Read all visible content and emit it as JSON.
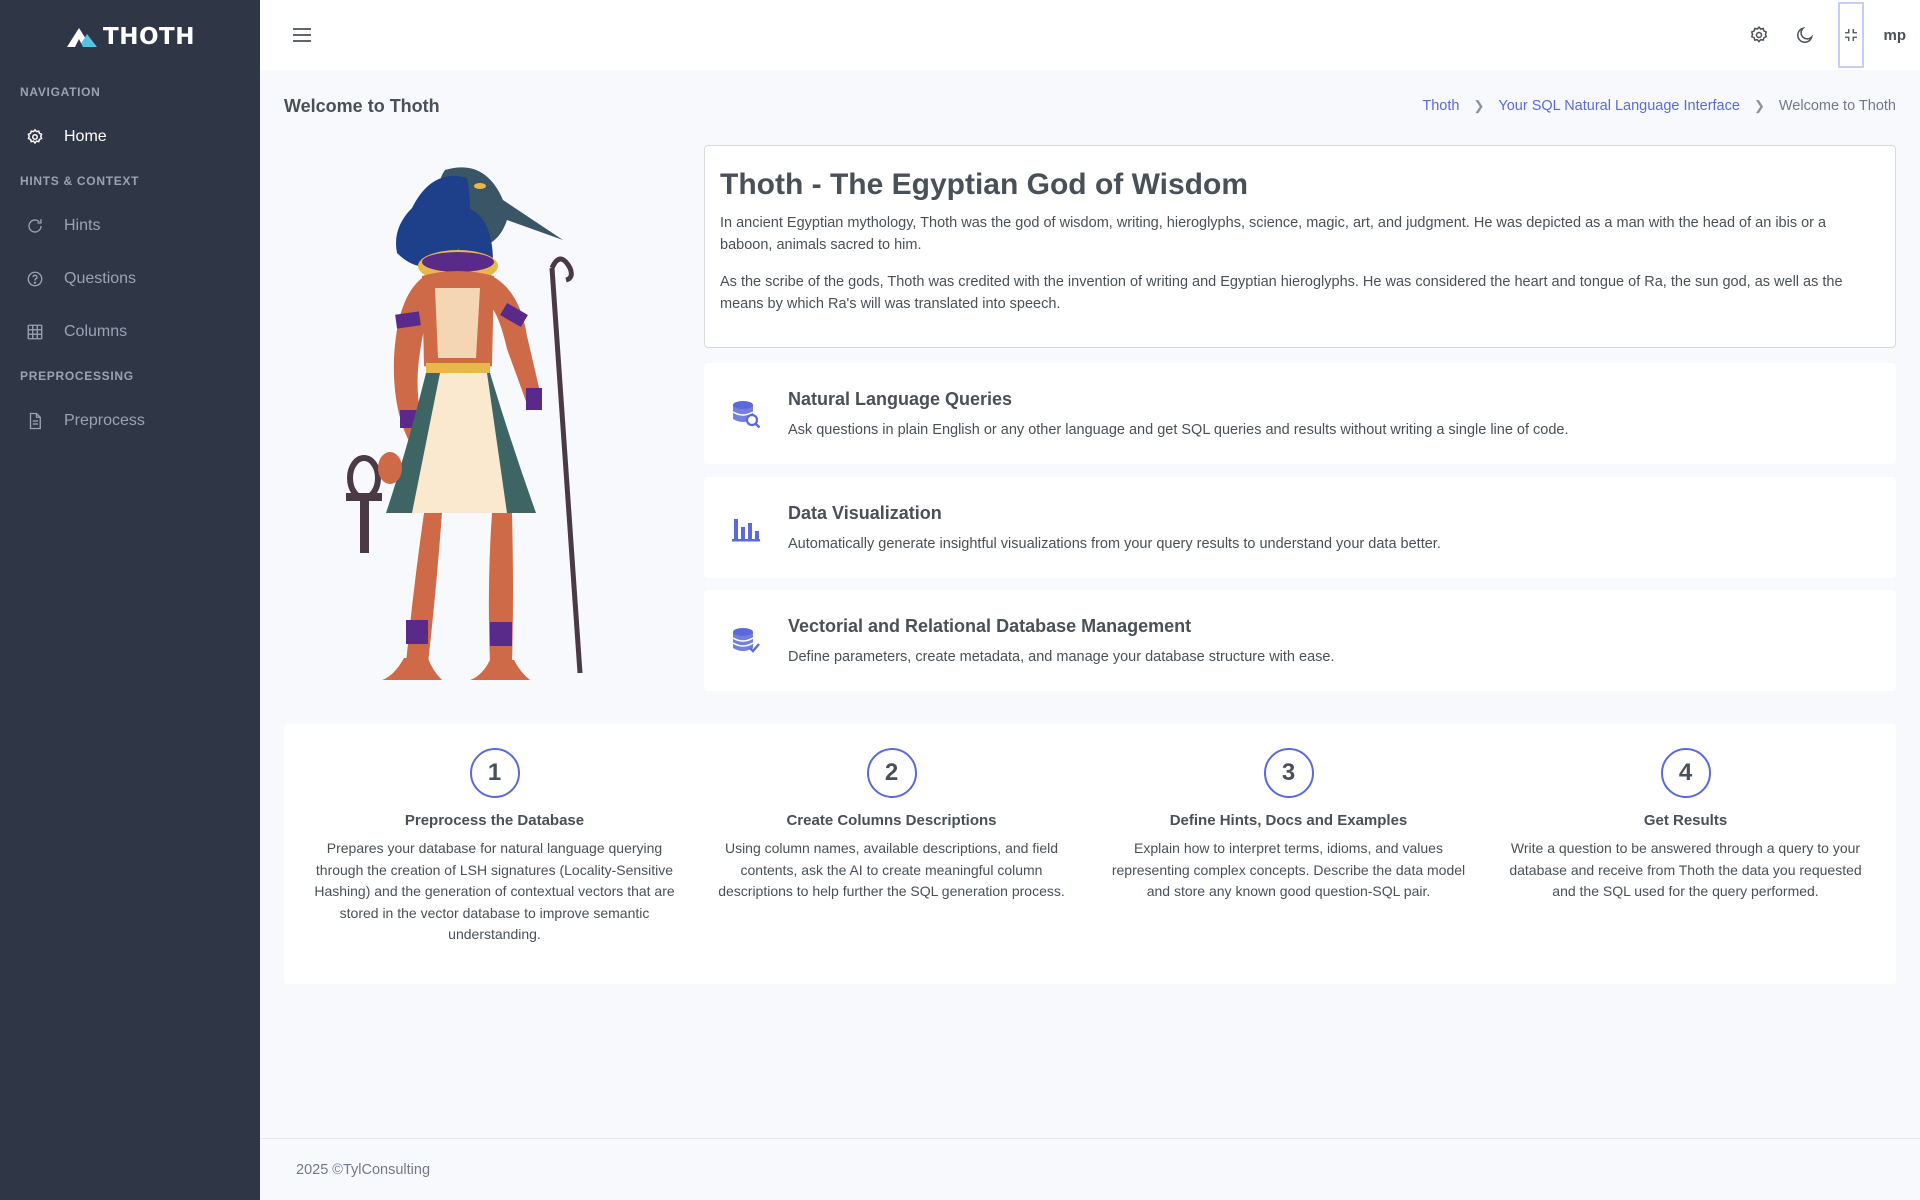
{
  "app": {
    "logo_text": "THOTH"
  },
  "sidebar": {
    "sections": [
      {
        "title": "NAVIGATION"
      },
      {
        "title": "HINTS & CONTEXT"
      },
      {
        "title": "PREPROCESSING"
      }
    ],
    "items": [
      {
        "label": "Home",
        "icon": "gear-icon",
        "active": true
      },
      {
        "label": "Hints",
        "icon": "refresh-icon",
        "active": false
      },
      {
        "label": "Questions",
        "icon": "question-circle-icon",
        "active": false
      },
      {
        "label": "Columns",
        "icon": "grid-icon",
        "active": false
      },
      {
        "label": "Preprocess",
        "icon": "document-icon",
        "active": false
      }
    ]
  },
  "topbar": {
    "menu_icon": "hamburger-icon",
    "settings_icon": "gear-icon",
    "theme_icon": "moon-icon",
    "fullscreen_icon": "exit-fullscreen-icon",
    "user_initials": "mp"
  },
  "page": {
    "title": "Welcome to Thoth",
    "breadcrumb": [
      "Thoth",
      "Your SQL Natural Language Interface",
      "Welcome to Thoth"
    ]
  },
  "intro": {
    "heading": "Thoth - The Egyptian God of Wisdom",
    "paragraphs": [
      "In ancient Egyptian mythology, Thoth was the god of wisdom, writing, hieroglyphs, science, magic, art, and judgment. He was depicted as a man with the head of an ibis or a baboon, animals sacred to him.",
      "As the scribe of the gods, Thoth was credited with the invention of writing and Egyptian hieroglyphs. He was considered the heart and tongue of Ra, the sun god, as well as the means by which Ra's will was translated into speech."
    ]
  },
  "features": [
    {
      "title": "Natural Language Queries",
      "description": "Ask questions in plain English or any other language and get SQL queries and results without writing a single line of code.",
      "icon": "database-search-icon"
    },
    {
      "title": "Data Visualization",
      "description": "Automatically generate insightful visualizations from your query results to understand your data better.",
      "icon": "bar-chart-icon"
    },
    {
      "title": "Vectorial and Relational Database Management",
      "description": "Define parameters, create metadata, and manage your database structure with ease.",
      "icon": "database-check-icon"
    }
  ],
  "steps": [
    {
      "number": "1",
      "title": "Preprocess the Database",
      "description": "Prepares your database for natural language querying through the creation of LSH signatures (Locality-Sensitive Hashing) and the generation of contextual vectors that are stored in the vector database to improve semantic understanding."
    },
    {
      "number": "2",
      "title": "Create Columns Descriptions",
      "description": "Using column names, available descriptions, and field contents, ask the AI to create meaningful column descriptions to help further the SQL generation process."
    },
    {
      "number": "3",
      "title": "Define Hints, Docs and Examples",
      "description": "Explain how to interpret terms, idioms, and values representing complex concepts. Describe the data model and store any known good question-SQL pair."
    },
    {
      "number": "4",
      "title": "Get Results",
      "description": "Write a question to be answered through a query to your database and receive from Thoth the data you requested and the SQL used for the query performed."
    }
  ],
  "footer": {
    "text": "2025 ©TylConsulting"
  },
  "colors": {
    "sidebar_bg": "#2f3747",
    "accent": "#5b6ad8",
    "page_bg": "#f8f9fc"
  }
}
